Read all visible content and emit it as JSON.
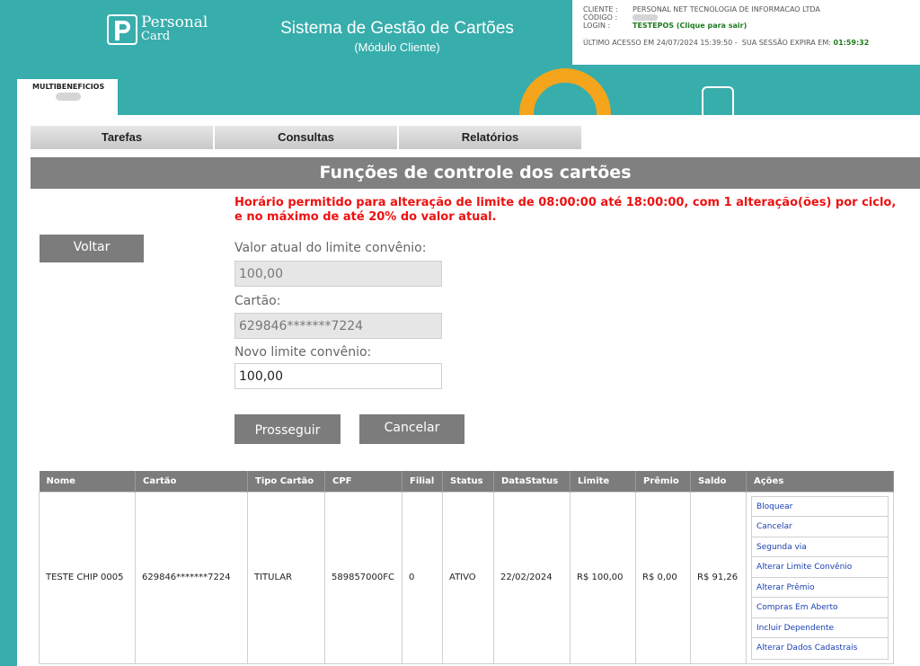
{
  "header": {
    "logo_line1": "Personal",
    "logo_line2": "Card",
    "system_title": "Sistema de Gestão de Cartões",
    "system_subtitle": "(Módulo Cliente)"
  },
  "client_info": {
    "cliente_label": "CLIENTE :",
    "cliente_value": "PERSONAL NET TECNOLOGIA DE INFORMACAO LTDA",
    "codigo_label": "CÓDIGO :",
    "login_label": "LOGIN :",
    "login_value": "TESTEPOS (Clique para sair)",
    "last_access": "ÚLTIMO ACESSO EM 24/07/2024 15:39:50 -",
    "session_label": "SUA SESSÃO EXPIRA EM:",
    "session_value": "01:59:32"
  },
  "tab": {
    "label": "MULTIBENEFICIOS"
  },
  "menu": {
    "items": [
      "Tarefas",
      "Consultas",
      "Relatórios"
    ]
  },
  "section_title": "Funções de controle dos cartões",
  "warning": "Horário permitido para alteração de limite de 08:00:00 até 18:00:00, com 1 alteração(ões) por ciclo, e no máximo de até 20% do valor atual.",
  "buttons": {
    "voltar": "Voltar",
    "prosseguir": "Prosseguir",
    "cancelar": "Cancelar"
  },
  "form": {
    "valor_atual_label": "Valor atual do limite convênio:",
    "valor_atual_value": "100,00",
    "cartao_label": "Cartão:",
    "cartao_value": "629846*******7224",
    "novo_limite_label": "Novo limite convênio:",
    "novo_limite_value": "100,00"
  },
  "table": {
    "headers": [
      "Nome",
      "Cartão",
      "Tipo Cartão",
      "CPF",
      "Filial",
      "Status",
      "DataStatus",
      "Limite",
      "Prêmio",
      "Saldo",
      "Ações"
    ],
    "row": [
      "TESTE CHIP 0005",
      "629846*******7224",
      "TITULAR",
      "589857000FC",
      "0",
      "ATIVO",
      "22/02/2024",
      "R$ 100,00",
      "R$ 0,00",
      "R$ 91,26"
    ],
    "actions": [
      "Bloquear",
      "Cancelar",
      "Segunda via",
      "Alterar Limite Convênio",
      "Alterar Prêmio",
      "Compras Em Aberto",
      "Incluir Dependente",
      "Alterar Dados Cadastrais"
    ]
  },
  "colors": {
    "teal": "#37adac",
    "orange": "#f4a51c",
    "gray": "#7c7c7c",
    "warning": "#ee1111",
    "link": "#1a3fb0"
  }
}
